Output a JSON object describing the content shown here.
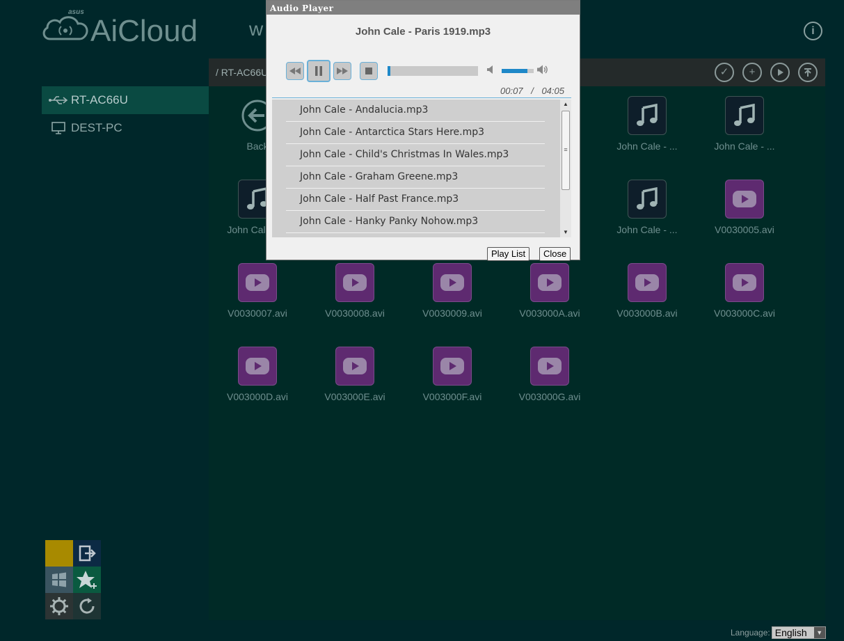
{
  "header": {
    "logo_small": "asus",
    "brand": "AiCloud",
    "partial_title": "w"
  },
  "toolbar": {
    "path": "/ RT-AC66U"
  },
  "sidebar": {
    "items": [
      {
        "label": "RT-AC66U",
        "icon": "usb-icon",
        "active": true
      },
      {
        "label": "DEST-PC",
        "icon": "monitor-icon",
        "active": false
      }
    ]
  },
  "files": [
    {
      "name": "Back",
      "type": "back"
    },
    {
      "name": "John Cale - ...",
      "type": "audio"
    },
    {
      "name": "John Cale - ...",
      "type": "audio"
    },
    {
      "name": "John Cal",
      "type": "audio"
    },
    {
      "name": "John Cale - ...",
      "type": "audio"
    },
    {
      "name": "V0030005.avi",
      "type": "video"
    },
    {
      "name": "V0030007.avi",
      "type": "video"
    },
    {
      "name": "V0030008.avi",
      "type": "video"
    },
    {
      "name": "V0030009.avi",
      "type": "video"
    },
    {
      "name": "V003000A.avi",
      "type": "video"
    },
    {
      "name": "V003000B.avi",
      "type": "video"
    },
    {
      "name": "V003000C.avi",
      "type": "video"
    },
    {
      "name": "V003000D.avi",
      "type": "video"
    },
    {
      "name": "V003000E.avi",
      "type": "video"
    },
    {
      "name": "V003000F.avi",
      "type": "video"
    },
    {
      "name": "V003000G.avi",
      "type": "video"
    }
  ],
  "player": {
    "title": "Audio Player",
    "track": "John Cale - Paris 1919.mp3",
    "current_time": "00:07",
    "separator": "/",
    "total_time": "04:05",
    "progress": 0.03,
    "volume": 0.8,
    "playlist": [
      "John Cale - Andalucia.mp3",
      "John Cale - Antarctica Stars Here.mp3",
      "John Cale - Child's Christmas In Wales.mp3",
      "John Cale - Graham Greene.mp3",
      "John Cale - Half Past France.mp3",
      "John Cale - Hanky Panky Nohow.mp3"
    ],
    "playlist_button": "Play List",
    "close_button": "Close"
  },
  "language": {
    "label": "Language:",
    "value": "English"
  },
  "colors": {
    "background": "#00272a",
    "main_panel": "#002a26",
    "accent_blue": "#1e88c8",
    "video_tile": "#5e2a70",
    "audio_tile": "#0e1e2a",
    "quick_yellow": "#a88a00"
  }
}
